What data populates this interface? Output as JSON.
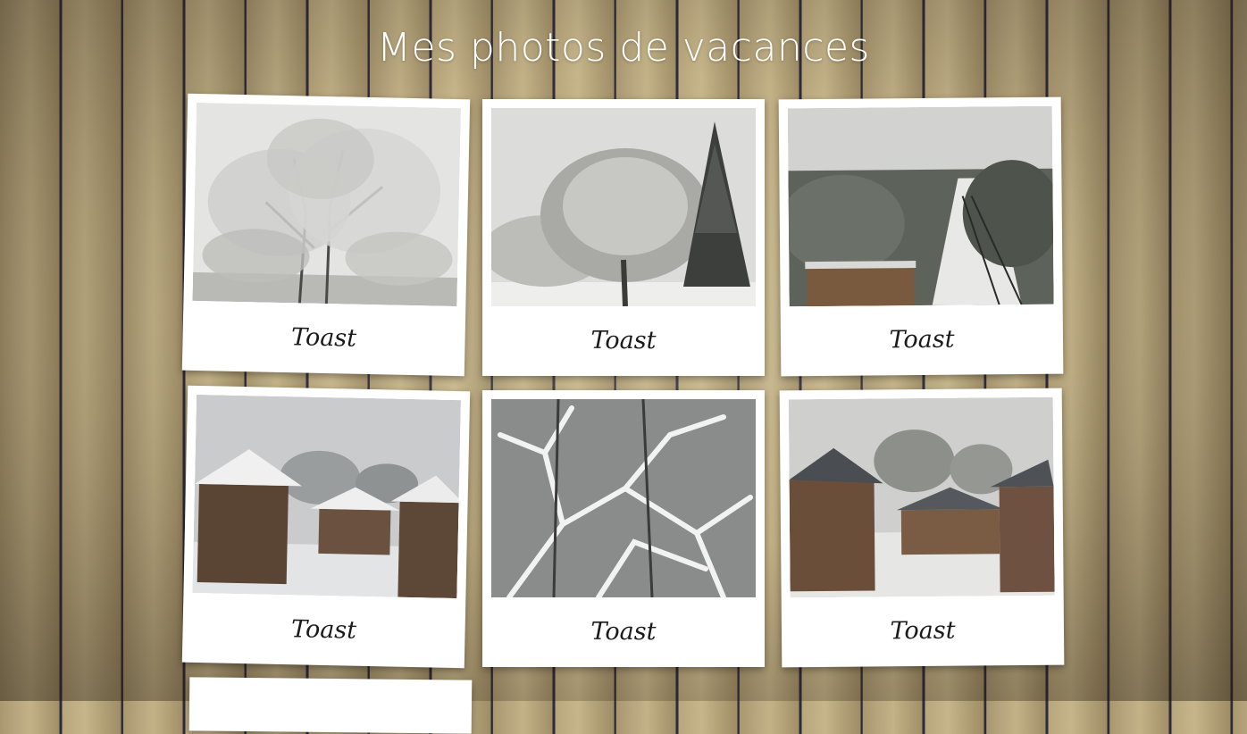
{
  "page": {
    "title": "Mes photos de vacances"
  },
  "gallery": {
    "items": [
      {
        "caption": "Toast",
        "scene": "frosted-tree"
      },
      {
        "caption": "Toast",
        "scene": "frosted-tree-and-fir"
      },
      {
        "caption": "Toast",
        "scene": "ski-slope-lift"
      },
      {
        "caption": "Toast",
        "scene": "snowy-chalets-fog"
      },
      {
        "caption": "Toast",
        "scene": "snow-branches"
      },
      {
        "caption": "Toast",
        "scene": "snowy-chalets"
      }
    ]
  }
}
